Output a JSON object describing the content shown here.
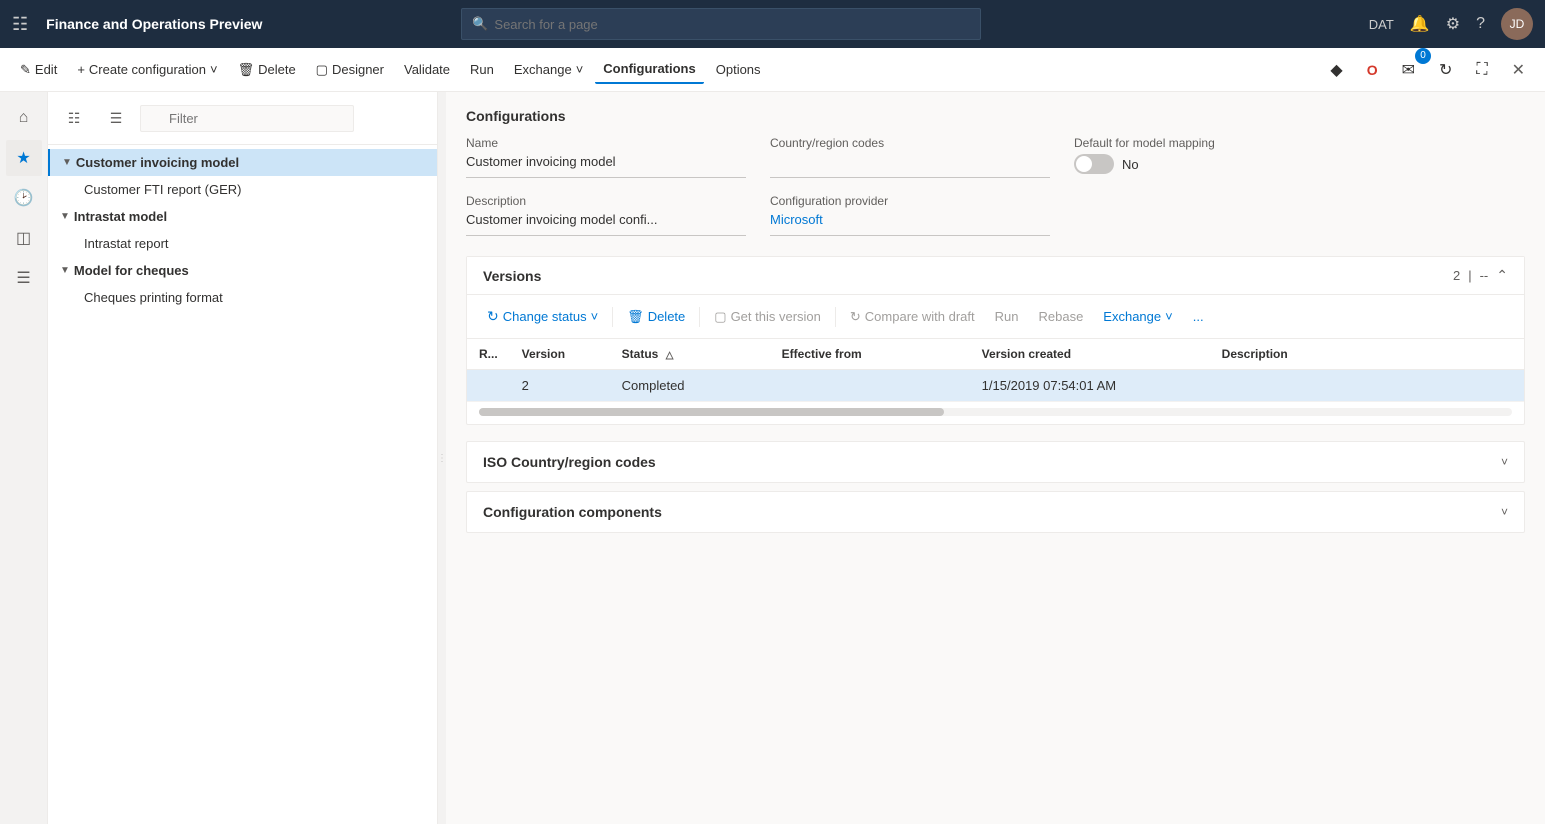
{
  "app": {
    "title": "Finance and Operations Preview",
    "env_label": "DAT"
  },
  "search": {
    "placeholder": "Search for a page"
  },
  "command_bar": {
    "edit": "Edit",
    "create_config": "Create configuration",
    "delete": "Delete",
    "designer": "Designer",
    "validate": "Validate",
    "run": "Run",
    "exchange": "Exchange",
    "configurations": "Configurations",
    "options": "Options"
  },
  "filter": {
    "placeholder": "Filter"
  },
  "tree": {
    "items": [
      {
        "id": "customer-invoicing-model",
        "label": "Customer invoicing model",
        "type": "parent",
        "expanded": true,
        "selected": true
      },
      {
        "id": "customer-fti-report",
        "label": "Customer FTI report (GER)",
        "type": "child"
      },
      {
        "id": "intrastat-model",
        "label": "Intrastat model",
        "type": "parent",
        "expanded": true
      },
      {
        "id": "intrastat-report",
        "label": "Intrastat report",
        "type": "child"
      },
      {
        "id": "model-for-cheques",
        "label": "Model for cheques",
        "type": "parent",
        "expanded": true
      },
      {
        "id": "cheques-printing-format",
        "label": "Cheques printing format",
        "type": "child"
      }
    ]
  },
  "config_detail": {
    "section_title": "Configurations",
    "name_label": "Name",
    "name_value": "Customer invoicing model",
    "country_label": "Country/region codes",
    "country_value": "",
    "default_mapping_label": "Default for model mapping",
    "default_mapping_value": "No",
    "description_label": "Description",
    "description_value": "Customer invoicing model confi...",
    "provider_label": "Configuration provider",
    "provider_value": "Microsoft"
  },
  "versions": {
    "title": "Versions",
    "count": "2",
    "separator": "--",
    "toolbar": {
      "change_status": "Change status",
      "delete": "Delete",
      "get_this_version": "Get this version",
      "compare_with_draft": "Compare with draft",
      "run": "Run",
      "rebase": "Rebase",
      "exchange": "Exchange",
      "more": "..."
    },
    "columns": {
      "r": "R...",
      "version": "Version",
      "status": "Status",
      "effective_from": "Effective from",
      "version_created": "Version created",
      "description": "Description"
    },
    "rows": [
      {
        "r": "",
        "version": "2",
        "status": "Completed",
        "effective_from": "",
        "version_created": "1/15/2019 07:54:01 AM",
        "description": "",
        "selected": true
      }
    ]
  },
  "iso_section": {
    "title": "ISO Country/region codes"
  },
  "config_components": {
    "title": "Configuration components"
  }
}
